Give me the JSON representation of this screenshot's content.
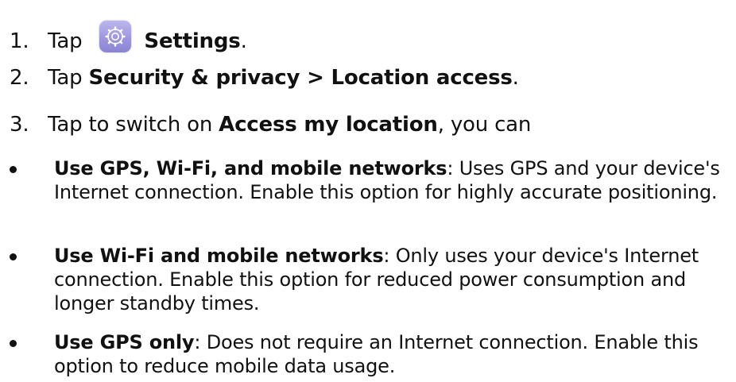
{
  "steps": [
    {
      "number": "1.",
      "prefix": "Tap",
      "icon": "settings-gear-icon",
      "bold": "Settings",
      "suffix": "."
    },
    {
      "number": "2.",
      "prefix": "Tap ",
      "bold": "Security & privacy > Location access",
      "suffix": "."
    },
    {
      "number": "3.",
      "prefix": "Tap to switch on ",
      "bold": "Access my location",
      "suffix": ", you can"
    }
  ],
  "options": [
    {
      "title": "Use GPS, Wi-Fi, and mobile networks",
      "description": ": Uses GPS and your device's Internet connection. Enable this option for highly accurate positioning."
    },
    {
      "title": "Use Wi-Fi and mobile networks",
      "description": ": Only uses your device's Internet connection. Enable this option for reduced power consumption and longer standby times."
    },
    {
      "title": "Use GPS only",
      "description": ": Does not require an Internet connection. Enable this option to reduce mobile data usage."
    }
  ],
  "colors": {
    "text": "#111111",
    "icon_background": "#9e97de",
    "icon_gear": "#ffffff"
  }
}
